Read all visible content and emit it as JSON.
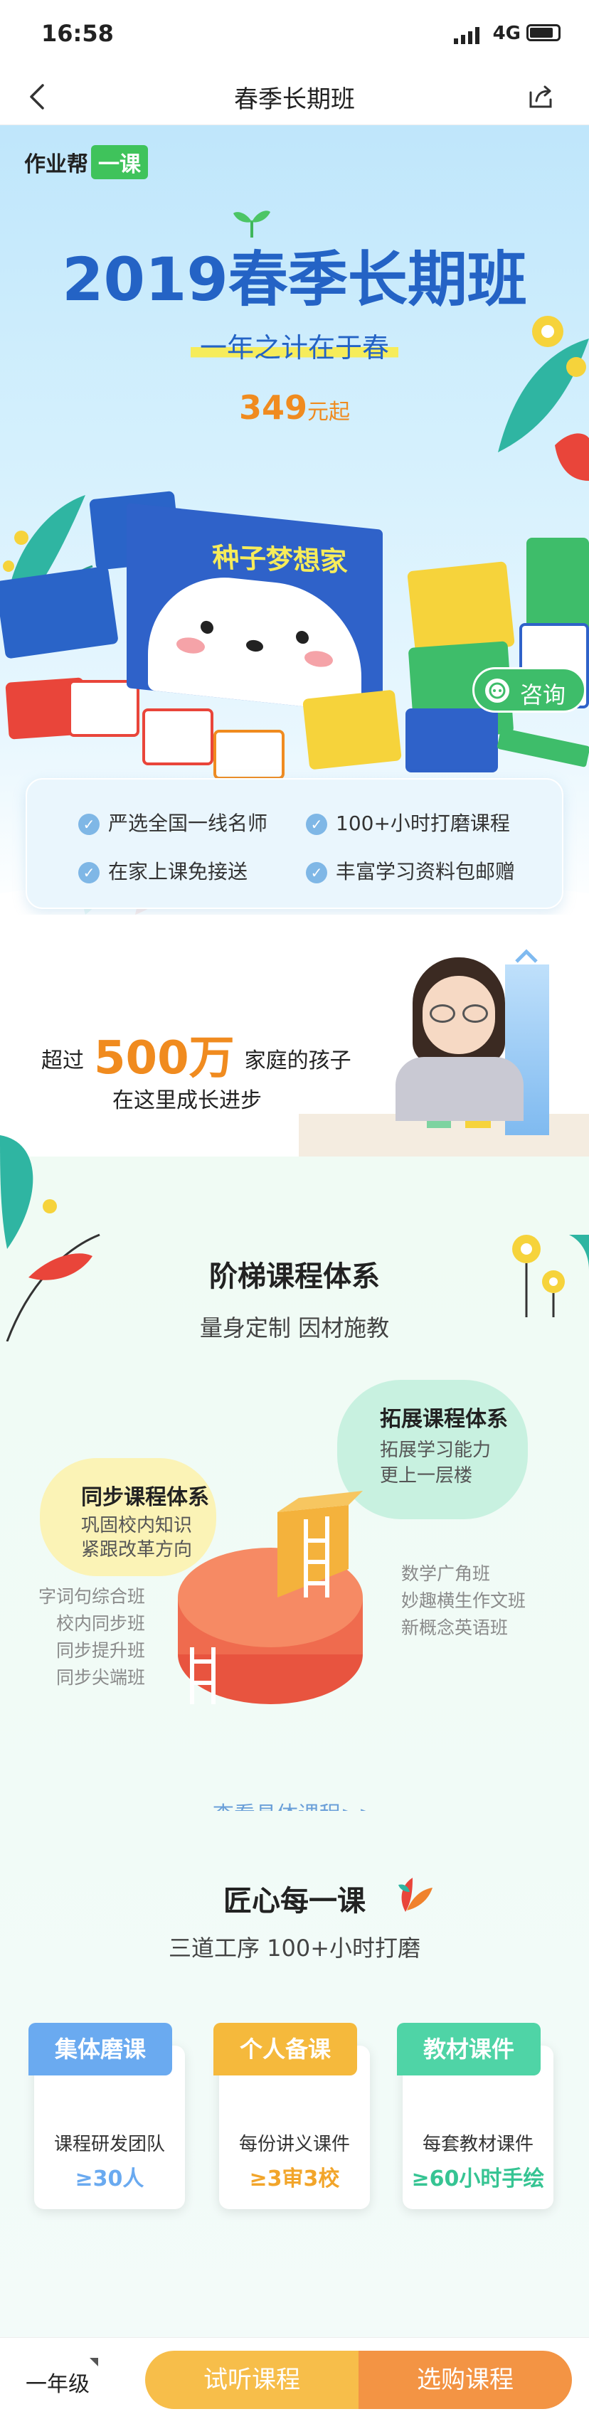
{
  "status_bar": {
    "time": "16:58",
    "network": "4G"
  },
  "nav": {
    "title": "春季长期班"
  },
  "hero": {
    "logo_text": "作业帮",
    "logo_tag": "一课",
    "title": "2019春季长期班",
    "subtitle": "一年之计在于春",
    "price_value": "349",
    "price_unit": "元起",
    "book_title": "种子梦想家",
    "consult_label": "咨询",
    "features": [
      "严选全国一线名师",
      "100+小时打磨课程",
      "在家上课免接送",
      "丰富学习资料包邮赠"
    ]
  },
  "families": {
    "prefix": "超过",
    "count": "500万",
    "suffix": "家庭的孩子",
    "line2": "在这里成长进步"
  },
  "ladder": {
    "title": "阶梯课程体系",
    "subtitle": "量身定制 因材施教",
    "sync": {
      "title": "同步课程体系",
      "desc1": "巩固校内知识",
      "desc2": "紧跟改革方向"
    },
    "expand": {
      "title": "拓展课程体系",
      "desc1": "拓展学习能力",
      "desc2": "更上一层楼"
    },
    "sync_list": [
      "字词句综合班",
      "校内同步班",
      "同步提升班",
      "同步尖端班"
    ],
    "expand_list": [
      "数学广角班",
      "妙趣横生作文班",
      "新概念英语班"
    ],
    "link": "查看具体课程>>"
  },
  "craft": {
    "title": "匠心每一课",
    "subtitle": "三道工序 100+小时打磨",
    "cards": [
      {
        "tab": "集体磨课",
        "text": "课程研发团队",
        "value": "≥30人",
        "color": "#6aaaf0",
        "value_color": "#6aaaf0"
      },
      {
        "tab": "个人备课",
        "text": "每份讲义课件",
        "value": "≥3审3校",
        "color": "#f5b93c",
        "value_color": "#f2a52a"
      },
      {
        "tab": "教材课件",
        "text": "每套教材课件",
        "value": "≥60小时手绘",
        "color": "#4fd4a6",
        "value_color": "#36c493"
      }
    ]
  },
  "bottom": {
    "grade": "一年级",
    "try_label": "试听课程",
    "buy_label": "选购课程"
  },
  "colors": {
    "primary_blue": "#2463c5",
    "accent_orange": "#f08b1f",
    "consult_green": "#3ebd6a"
  }
}
